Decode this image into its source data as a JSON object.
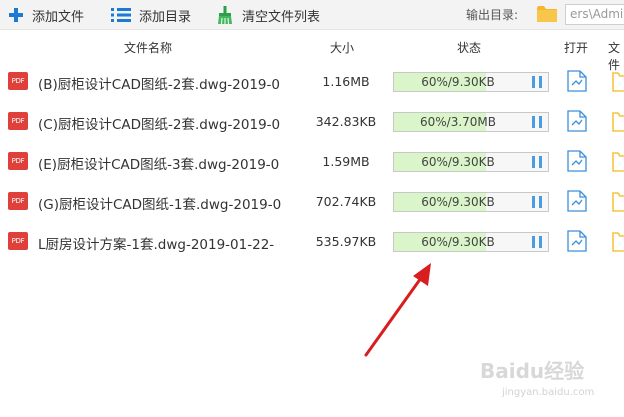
{
  "toolbar": {
    "add_file_label": "添加文件",
    "add_dir_label": "添加目录",
    "clear_label": "清空文件列表",
    "output_label": "输出目录:",
    "output_path": "ers\\Admin"
  },
  "columns": {
    "name": "文件名称",
    "size": "大小",
    "status": "状态",
    "open": "打开",
    "folder": "文件"
  },
  "files": [
    {
      "icon_text": "PDF",
      "name": "(B)厨柜设计CAD图纸-2套.dwg-2019-0",
      "size": "1.16MB",
      "status": "60%/9.30KB",
      "progress": 0.6
    },
    {
      "icon_text": "PDF",
      "name": "(C)厨柜设计CAD图纸-2套.dwg-2019-0",
      "size": "342.83KB",
      "status": "60%/3.70MB",
      "progress": 0.6
    },
    {
      "icon_text": "PDF",
      "name": "(E)厨柜设计CAD图纸-3套.dwg-2019-0",
      "size": "1.59MB",
      "status": "60%/9.30KB",
      "progress": 0.6
    },
    {
      "icon_text": "PDF",
      "name": "(G)厨柜设计CAD图纸-1套.dwg-2019-0",
      "size": "702.74KB",
      "status": "60%/9.30KB",
      "progress": 0.6
    },
    {
      "icon_text": "PDF",
      "name": "L厨房设计方案-1套.dwg-2019-01-22-",
      "size": "535.97KB",
      "status": "60%/9.30KB",
      "progress": 0.6
    }
  ],
  "watermark": {
    "main": "Baidu经验",
    "sub": "jingyan.baidu.com"
  },
  "colors": {
    "accent": "#1a7ad4",
    "progress_fill": "#d9f5c9",
    "pdf_red": "#e0403a",
    "arrow_red": "#d81e1e",
    "folder_yellow": "#f5c542"
  }
}
